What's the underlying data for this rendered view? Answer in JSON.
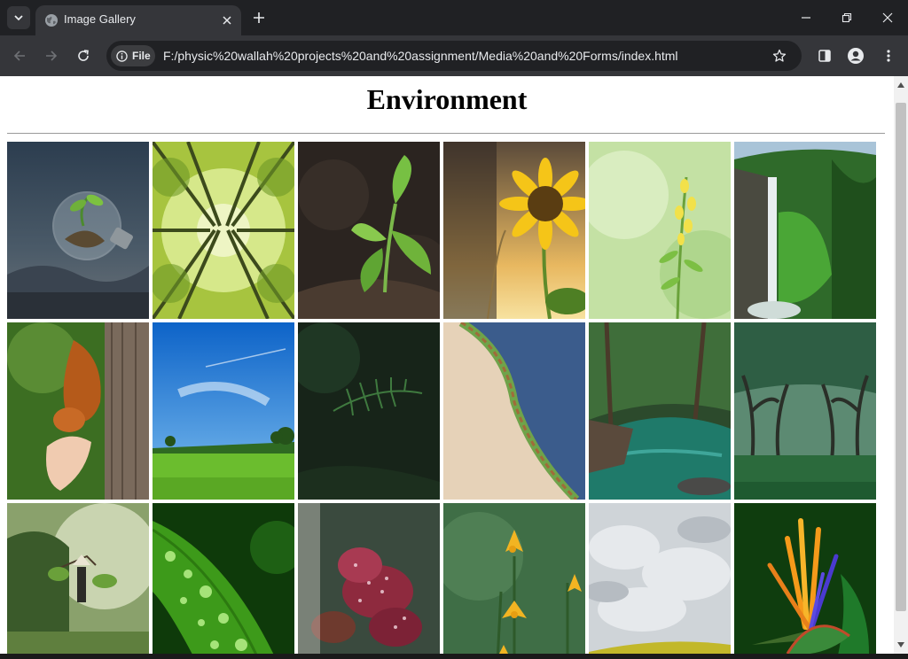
{
  "browser": {
    "tab_title": "Image Gallery",
    "omnibox_chip": "File",
    "url": "F:/physic%20wallah%20projects%20and%20assignment/Media%20and%20Forms/index.html"
  },
  "page": {
    "heading": "Environment"
  },
  "gallery": {
    "images": [
      "lightbulb-seedling",
      "forest-canopy",
      "green-sprout",
      "sunflower-sunset",
      "yellow-wildflower",
      "waterfall-cliff",
      "squirrel-hand",
      "blue-sky-meadow",
      "dark-fern",
      "aerial-coastline",
      "forest-river",
      "tree-lined-park",
      "rice-farmer",
      "leaf-dewdrops",
      "red-dewy-leaves",
      "yellow-lilies",
      "cloudy-field",
      "bird-of-paradise"
    ]
  },
  "colors": {
    "chrome_dark": "#202124",
    "chrome_mid": "#35363a",
    "chrome_text": "#e8eaed",
    "page_bg": "#ffffff"
  }
}
